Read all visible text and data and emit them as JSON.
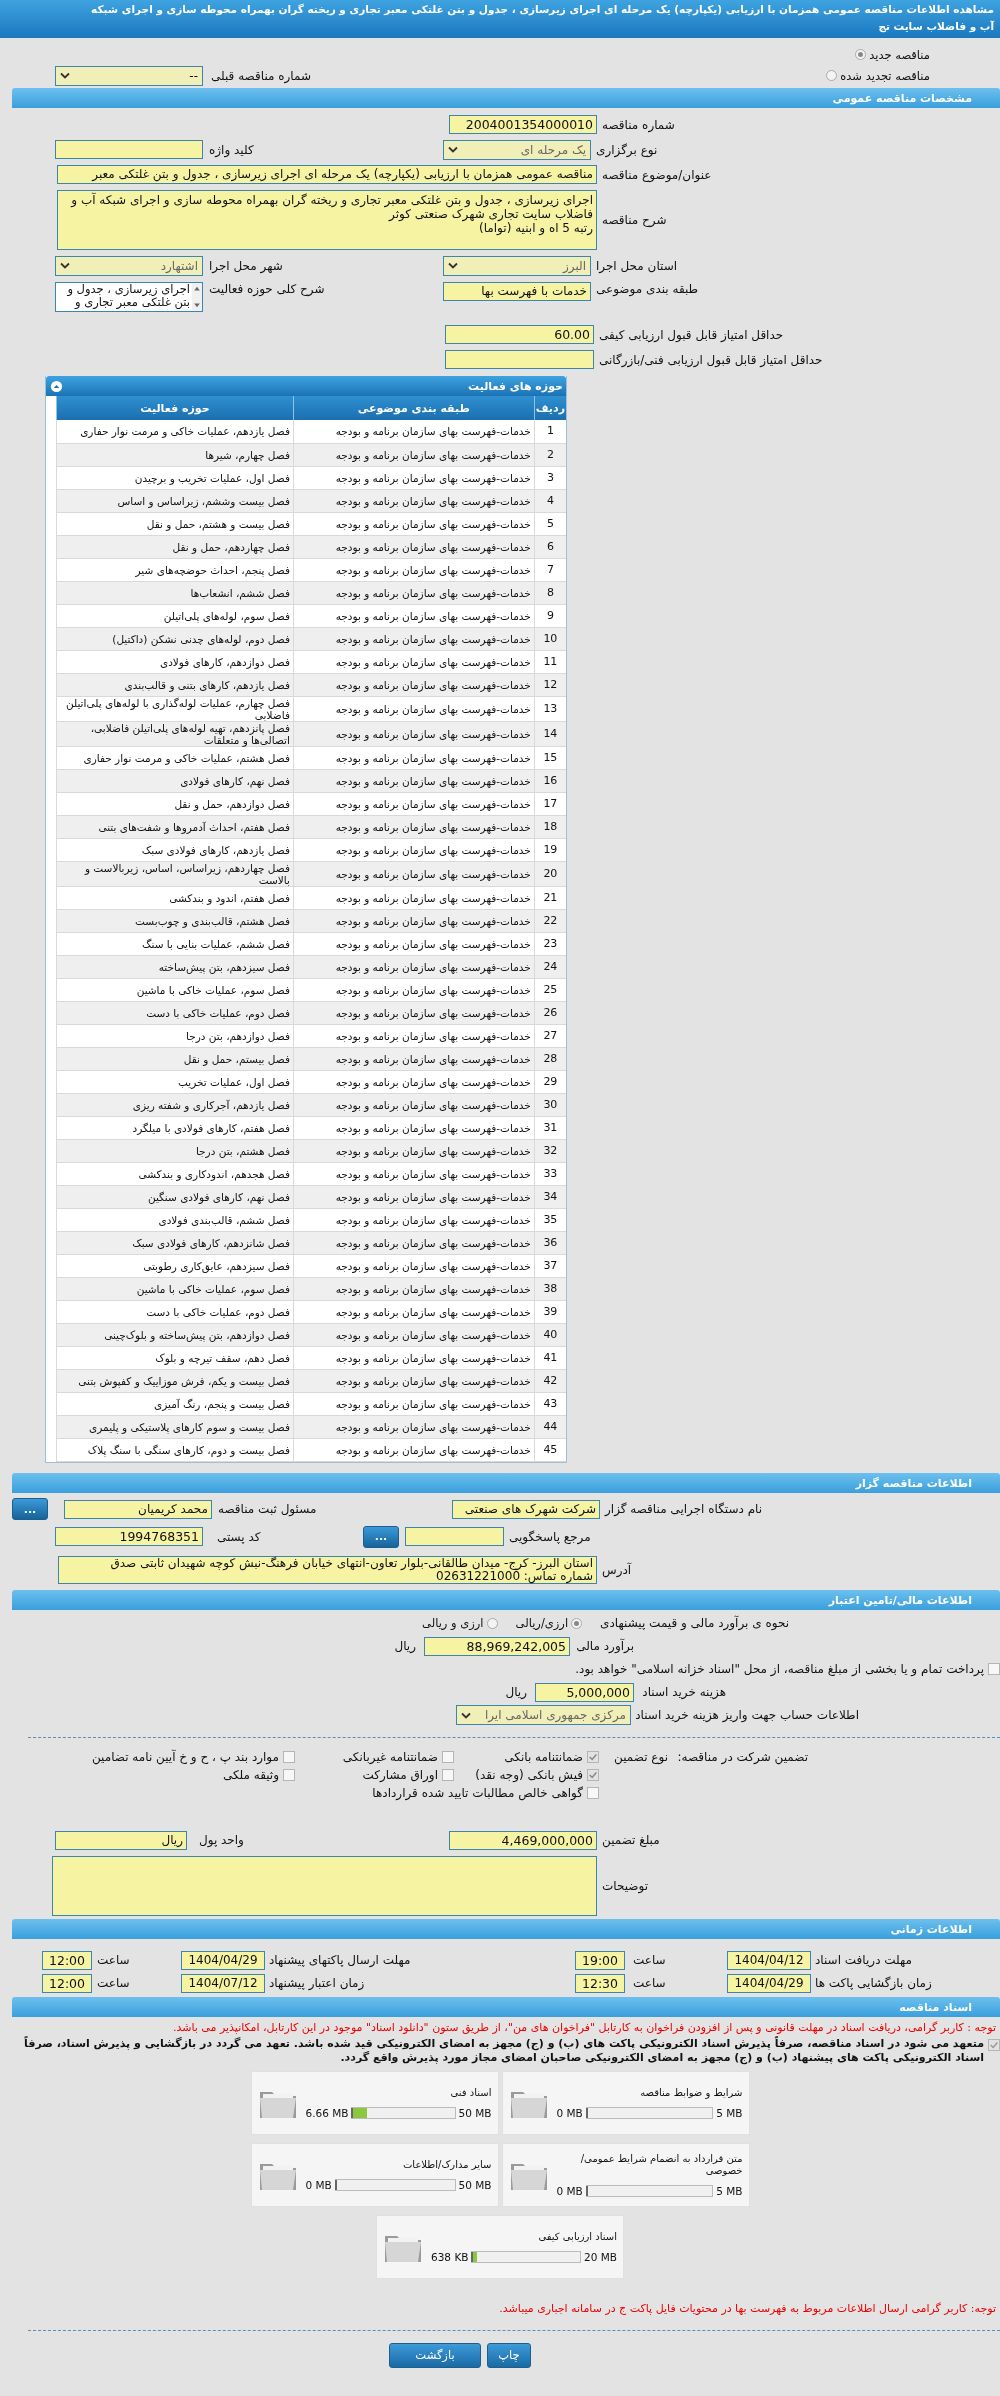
{
  "title_lines": [
    "مشاهده اطلاعات مناقصه عمومی همزمان با ارزیابی (یکپارچه) یک مرحله ای اجرای زیرسازی ، جدول و بتن غلتکی معبر تجاری و ریخته گران بهمراه محوطه سازی و اجرای شبکه",
    "آب و فاضلاب سایت تج"
  ],
  "tender_kind": [
    {
      "label": "مناقصه جدید",
      "selected": true
    },
    {
      "label": "مناقصه تجدید شده",
      "selected": false
    }
  ],
  "previous_tender": {
    "label": "شماره مناقصه قبلی",
    "value": "--"
  },
  "general": {
    "header": "مشخصات مناقصه عمومی",
    "tender_number": {
      "label": "شماره مناقصه",
      "value": "2004001354000010"
    },
    "holding_type": {
      "label": "نوع برگزاری",
      "value": "یک مرحله ای"
    },
    "keyword": {
      "label": "کلید واژه"
    },
    "subject": {
      "label": "عنوان/موضوع مناقصه",
      "value": "مناقصه عمومی همزمان با ارزیابی (یکپارچه) یک مرحله ای اجرای زیرسازی ، جدول و بتن غلتکی معبر"
    },
    "description": {
      "label": "شرح مناقصه",
      "value": "اجرای زیرسازی ، جدول و بتن غلتکی معبر تجاری و ریخته گران بهمراه محوطه سازی و اجرای شبکه آب و\nفاضلاب سایت تجاری شهرک صنعتی کوثر\nرتبه 5 اه و ابنیه (تواما)"
    },
    "province": {
      "label": "استان محل اجرا",
      "value": "البرز"
    },
    "city": {
      "label": "شهر محل اجرا",
      "value": "اشتهارد"
    },
    "category": {
      "label": "طبقه بندی موضوعی",
      "value": "خدمات با فهرست بها"
    },
    "activity_summary": {
      "label": "شرح کلی حوزه فعالیت",
      "value": "اجرای زیرسازی ، جدول و\nبتن غلتکی معبر تجاری و"
    },
    "min_quality_score": {
      "label": "حداقل امتیاز قابل قبول ارزیابی کیفی",
      "value": "60.00"
    },
    "min_technical_score": {
      "label": "حداقل امتیاز قابل قبول ارزیابی فنی/بازرگانی"
    }
  },
  "activities": {
    "title": "حوزه های فعالیت",
    "columns": [
      "ردیف",
      "طبقه بندی موضوعی",
      "حوزه فعالیت"
    ],
    "rows": [
      {
        "index": "1",
        "category": "خدمات-فهرست بهای سازمان برنامه و بودجه",
        "activity": "فصل یازدهم، عملیات خاکی و مرمت نوار حفاری"
      },
      {
        "index": "2",
        "category": "خدمات-فهرست بهای سازمان برنامه و بودجه",
        "activity": "فصل چهارم، شیرها"
      },
      {
        "index": "3",
        "category": "خدمات-فهرست بهای سازمان برنامه و بودجه",
        "activity": "فصل اول، عملیات تخریب و برچیدن"
      },
      {
        "index": "4",
        "category": "خدمات-فهرست بهای سازمان برنامه و بودجه",
        "activity": "فصل بیست وششم، زیراساس و اساس"
      },
      {
        "index": "5",
        "category": "خدمات-فهرست بهای سازمان برنامه و بودجه",
        "activity": "فصل بیست و هشتم، حمل و نقل"
      },
      {
        "index": "6",
        "category": "خدمات-فهرست بهای سازمان برنامه و بودجه",
        "activity": "فصل چهاردهم، حمل و نقل"
      },
      {
        "index": "7",
        "category": "خدمات-فهرست بهای سازمان برنامه و بودجه",
        "activity": "فصل پنجم، احداث حوضچه‌های شیر"
      },
      {
        "index": "8",
        "category": "خدمات-فهرست بهای سازمان برنامه و بودجه",
        "activity": "فصل ششم، انشعاب‌ها"
      },
      {
        "index": "9",
        "category": "خدمات-فهرست بهای سازمان برنامه و بودجه",
        "activity": "فصل سوم، لوله‌های پلی‌اتیلن"
      },
      {
        "index": "10",
        "category": "خدمات-فهرست بهای سازمان برنامه و بودجه",
        "activity": "فصل دوم، لوله‌های چدنی نشکن (داکتیل)"
      },
      {
        "index": "11",
        "category": "خدمات-فهرست بهای سازمان برنامه و بودجه",
        "activity": "فصل دوازدهم، کارهای فولادی"
      },
      {
        "index": "12",
        "category": "خدمات-فهرست بهای سازمان برنامه و بودجه",
        "activity": "فصل یازدهم، کارهای بتنی و قالب‌بندی"
      },
      {
        "index": "13",
        "category": "خدمات-فهرست بهای سازمان برنامه و بودجه",
        "activity": "فصل چهارم، عملیات لوله‌گذاری با لوله‌های پلی‌اتیلن فاضلابی"
      },
      {
        "index": "14",
        "category": "خدمات-فهرست بهای سازمان برنامه و بودجه",
        "activity": "فصل پانزدهم، تهیه لوله‌های پلی‌اتیلن فاضلابی، اتصالی‌ها و متعلقات"
      },
      {
        "index": "15",
        "category": "خدمات-فهرست بهای سازمان برنامه و بودجه",
        "activity": "فصل هشتم، عملیات خاکی و مرمت نوار حفاری"
      },
      {
        "index": "16",
        "category": "خدمات-فهرست بهای سازمان برنامه و بودجه",
        "activity": "فصل نهم، کارهای فولادی"
      },
      {
        "index": "17",
        "category": "خدمات-فهرست بهای سازمان برنامه و بودجه",
        "activity": "فصل دوازدهم، حمل و نقل"
      },
      {
        "index": "18",
        "category": "خدمات-فهرست بهای سازمان برنامه و بودجه",
        "activity": "فصل هفتم، احداث آدمروها و شفت‌های بتنی"
      },
      {
        "index": "19",
        "category": "خدمات-فهرست بهای سازمان برنامه و بودجه",
        "activity": "فصل یازدهم، کارهای فولادی سبک"
      },
      {
        "index": "20",
        "category": "خدمات-فهرست بهای سازمان برنامه و بودجه",
        "activity": "فصل چهاردهم، زیراساس، اساس، زیربالاست و بالاست"
      },
      {
        "index": "21",
        "category": "خدمات-فهرست بهای سازمان برنامه و بودجه",
        "activity": "فصل هفتم، اندود و بندکشی"
      },
      {
        "index": "22",
        "category": "خدمات-فهرست بهای سازمان برنامه و بودجه",
        "activity": "فصل هشتم، قالب‌بندی و چوب‌بست"
      },
      {
        "index": "23",
        "category": "خدمات-فهرست بهای سازمان برنامه و بودجه",
        "activity": "فصل ششم، عملیات بنایی با سنگ"
      },
      {
        "index": "24",
        "category": "خدمات-فهرست بهای سازمان برنامه و بودجه",
        "activity": "فصل سیزدهم، بتن پیش‌ساخته"
      },
      {
        "index": "25",
        "category": "خدمات-فهرست بهای سازمان برنامه و بودجه",
        "activity": "فصل سوم، عملیات خاکی با ماشین"
      },
      {
        "index": "26",
        "category": "خدمات-فهرست بهای سازمان برنامه و بودجه",
        "activity": "فصل دوم، عملیات خاکی با دست"
      },
      {
        "index": "27",
        "category": "خدمات-فهرست بهای سازمان برنامه و بودجه",
        "activity": "فصل دوازدهم، بتن درجا"
      },
      {
        "index": "28",
        "category": "خدمات-فهرست بهای سازمان برنامه و بودجه",
        "activity": "فصل بیستم، حمل و نقل"
      },
      {
        "index": "29",
        "category": "خدمات-فهرست بهای سازمان برنامه و بودجه",
        "activity": "فصل اول، عملیات تخریب"
      },
      {
        "index": "30",
        "category": "خدمات-فهرست بهای سازمان برنامه و بودجه",
        "activity": "فصل یازدهم، آجرکاری و شفته ریزی"
      },
      {
        "index": "31",
        "category": "خدمات-فهرست بهای سازمان برنامه و بودجه",
        "activity": "فصل هفتم، کارهای فولادی با میلگرد"
      },
      {
        "index": "32",
        "category": "خدمات-فهرست بهای سازمان برنامه و بودجه",
        "activity": "فصل هشتم، بتن درجا"
      },
      {
        "index": "33",
        "category": "خدمات-فهرست بهای سازمان برنامه و بودجه",
        "activity": "فصل هجدهم، اندودکاری و بندکشی"
      },
      {
        "index": "34",
        "category": "خدمات-فهرست بهای سازمان برنامه و بودجه",
        "activity": "فصل نهم، کارهای فولادی سنگین"
      },
      {
        "index": "35",
        "category": "خدمات-فهرست بهای سازمان برنامه و بودجه",
        "activity": "فصل ششم، قالب‌بندی فولادی"
      },
      {
        "index": "36",
        "category": "خدمات-فهرست بهای سازمان برنامه و بودجه",
        "activity": "فصل شانزدهم، کارهای فولادی سبک"
      },
      {
        "index": "37",
        "category": "خدمات-فهرست بهای سازمان برنامه و بودجه",
        "activity": "فصل سیزدهم، عایق‌کاری رطوبتی"
      },
      {
        "index": "38",
        "category": "خدمات-فهرست بهای سازمان برنامه و بودجه",
        "activity": "فصل سوم، عملیات خاکی با ماشین"
      },
      {
        "index": "39",
        "category": "خدمات-فهرست بهای سازمان برنامه و بودجه",
        "activity": "فصل دوم، عملیات خاکی با دست"
      },
      {
        "index": "40",
        "category": "خدمات-فهرست بهای سازمان برنامه و بودجه",
        "activity": "فصل دوازدهم، بتن پیش‌ساخته و بلوک‌چینی"
      },
      {
        "index": "41",
        "category": "خدمات-فهرست بهای سازمان برنامه و بودجه",
        "activity": "فصل دهم، سقف تیرچه و بلوک"
      },
      {
        "index": "42",
        "category": "خدمات-فهرست بهای سازمان برنامه و بودجه",
        "activity": "فصل بیست و یکم، فرش موزاییک و کفپوش بتنی"
      },
      {
        "index": "43",
        "category": "خدمات-فهرست بهای سازمان برنامه و بودجه",
        "activity": "فصل بیست و پنجم، رنگ آمیزی"
      },
      {
        "index": "44",
        "category": "خدمات-فهرست بهای سازمان برنامه و بودجه",
        "activity": "فصل بیست و سوم کارهای پلاستیکی و پلیمری"
      },
      {
        "index": "45",
        "category": "خدمات-فهرست بهای سازمان برنامه و بودجه",
        "activity": "فصل بیست و دوم، کارهای سنگی با سنگ پلاک"
      }
    ]
  },
  "organizer": {
    "header": "اطلاعات مناقصه گزار",
    "org_name": {
      "label": "نام دستگاه اجرایی مناقصه گزار",
      "value": "شرکت شهرک های صنعتی"
    },
    "registrar": {
      "label": "مسئول ثبت مناقصه",
      "value": "محمد کریمیان",
      "button": "..."
    },
    "response_ref": {
      "label": "مرجع پاسخگویی",
      "button": "..."
    },
    "postal_code": {
      "label": "کد پستی",
      "value": "1994768351"
    },
    "address": {
      "label": "آدرس",
      "value": "استان البرز- کرج- میدان طالقانی-بلوار تعاون-انتهای خیابان فرهنگ-نبش کوچه شهیدان ثابتی صدق\nشماره تماس: 02631221000"
    }
  },
  "finance": {
    "header": "اطلاعات مالی/تامین اعتبار",
    "pricing": {
      "label": "نحوه ی برآورد مالی و قیمت پیشنهادی",
      "options": [
        {
          "label": "ارزی/ریالی",
          "selected": true
        },
        {
          "label": "ارزی و ریالی",
          "selected": false
        }
      ]
    },
    "estimate": {
      "label": "برآورد مالی",
      "value": "88,969,242,005",
      "unit": "ریال"
    },
    "treasury": {
      "label": "پرداخت تمام و یا بخشی از مبلغ مناقصه، از محل \"اسناد خزانه اسلامی\" خواهد بود.",
      "checked": false
    },
    "doc_fee": {
      "label": "هزینه خرید اسناد",
      "value": "5,000,000",
      "unit": "ریال"
    },
    "account": {
      "label": "اطلاعات حساب جهت واریز هزینه خرید اسناد",
      "value": "مرکزی جمهوری اسلامی ایرا"
    },
    "guarantee": {
      "label": "تضمین شرکت در مناقصه:",
      "type_label": "نوع تضمین",
      "options": [
        {
          "label": "ضمانتنامه بانکی",
          "checked": true
        },
        {
          "label": "ضمانتنامه غیربانکی",
          "checked": false
        },
        {
          "label": "موارد بند پ ، ح و خ آیین نامه تضامین",
          "checked": false
        },
        {
          "label": "فیش بانکی (وجه نقد)",
          "checked": true
        },
        {
          "label": "اوراق مشارکت",
          "checked": false
        },
        {
          "label": "وثیقه ملکی",
          "checked": false
        },
        {
          "label": "گواهی خالص مطالبات تایید شده قراردادها",
          "checked": false
        }
      ]
    },
    "guarantee_amount": {
      "label": "مبلغ تضمین",
      "value": "4,469,000,000"
    },
    "currency": {
      "label": "واحد پول",
      "value": "ریال"
    },
    "notes": {
      "label": "توضیحات"
    }
  },
  "timing": {
    "header": "اطلاعات زمانی",
    "items": [
      {
        "label": "مهلت دریافت اسناد",
        "date": "1404/04/12",
        "time_label": "ساعت",
        "time": "19:00"
      },
      {
        "label": "مهلت ارسال پاکتهای پیشنهاد",
        "date": "1404/04/29",
        "time_label": "ساعت",
        "time": "12:00"
      },
      {
        "label": "زمان بازگشایی پاکت ها",
        "date": "1404/04/29",
        "time_label": "ساعت",
        "time": "12:30"
      },
      {
        "label": "زمان اعتبار پیشنهاد",
        "date": "1404/07/12",
        "time_label": "ساعت",
        "time": "12:00"
      }
    ]
  },
  "documents": {
    "header": "اسناد مناقصه",
    "notice": "توجه : کاربر گرامی، دریافت اسناد در مهلت قانونی و پس از افزودن فراخوان به کارتابل \"فراخوان های من\"، از طریق ستون \"دانلود اسناد\" موجود در این کارتابل، امکانپذیر می باشد.",
    "commitment": {
      "text": "متعهد می شود در اسناد مناقصه، صرفاً پذیرش اسناد الکترونیکی پاکت های (ب) و (ج) مجهز به امضای الکترونیکی قید شده باشد. تعهد می گردد در بازگشایی و پذیرش اسناد، صرفاً اسناد الکترونیکی پاکت های پیشنهاد (ب) و (ج) مجهز به امضای الکترونیکی صاحبان امضای مجاز مورد پذیرش واقع گردد.",
      "checked": true
    },
    "files": [
      {
        "name": "شرایط و ضوابط مناقصه",
        "used": "0 MB",
        "max": "5 MB",
        "level": 0
      },
      {
        "name": "اسناد فنی",
        "used": "6.66 MB",
        "max": "50 MB",
        "level": 0.13
      },
      {
        "name": "متن قرارداد به انضمام شرایط عمومی/خصوصی",
        "used": "0 MB",
        "max": "5 MB",
        "level": 0
      },
      {
        "name": "سایر مدارک/اطلاعات",
        "used": "0 MB",
        "max": "50 MB",
        "level": 0
      },
      {
        "name": "اسناد ارزیابی کیفی",
        "used": "638 KB",
        "max": "20 MB",
        "level": 0.03
      }
    ],
    "footer_note": "توجه: کاربر گرامی ارسال اطلاعات مربوط به فهرست بها در محتویات فایل پاکت ج در سامانه اجباری میباشد."
  },
  "buttons": [
    "چاپ",
    "بازگشت"
  ]
}
